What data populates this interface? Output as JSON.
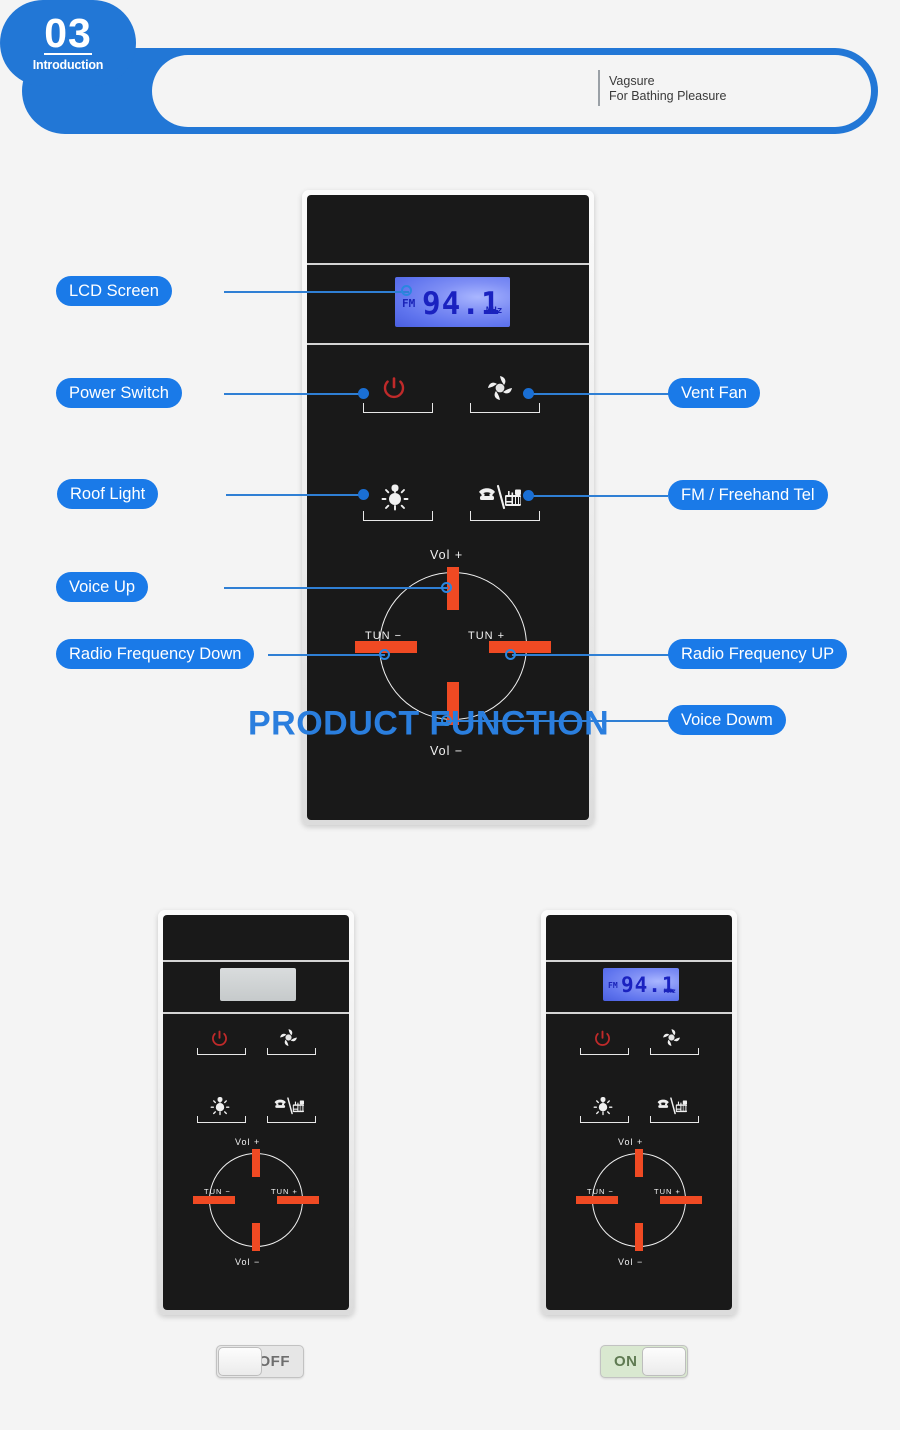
{
  "header": {
    "badge_number": "03",
    "badge_sub": "Introduction",
    "title": "PRODUCT FUNCTION",
    "brand_line1": "Vagsure",
    "brand_line2": "For Bathing Pleasure",
    "accent_color": "#2277d6",
    "title_color": "#2a7ede"
  },
  "labels": {
    "lcd_screen": "LCD Screen",
    "power_switch": "Power Switch",
    "roof_light": "Roof Light",
    "voice_up": "Voice Up",
    "radio_freq_down": "Radio Frequency Down",
    "vent_fan": "Vent Fan",
    "fm_freehand_tel": "FM / Freehand Tel",
    "radio_freq_up": "Radio Frequency UP",
    "voice_down": "Voice Dowm"
  },
  "display": {
    "band": "FM",
    "frequency": "94.1",
    "unit": "MHz",
    "backlit_color": "#7f8ff5",
    "digit_color": "#1a22c0",
    "off_color": "#cfd3d4"
  },
  "dial": {
    "vol_up": "Vol +",
    "vol_down": "Vol −",
    "tun_minus": "TUN −",
    "tun_plus": "TUN +",
    "bar_color": "#f04a23"
  },
  "icons": {
    "power": "power-icon",
    "fan": "fan-icon",
    "light": "light-bulb-icon",
    "phone_radio": "phone-radio-icon",
    "power_color": "#c02a2a",
    "icon_color": "#f2f2f2"
  },
  "states": {
    "off_label": "OFF",
    "on_label": "ON",
    "on_bg_color": "#d9e8d0"
  }
}
